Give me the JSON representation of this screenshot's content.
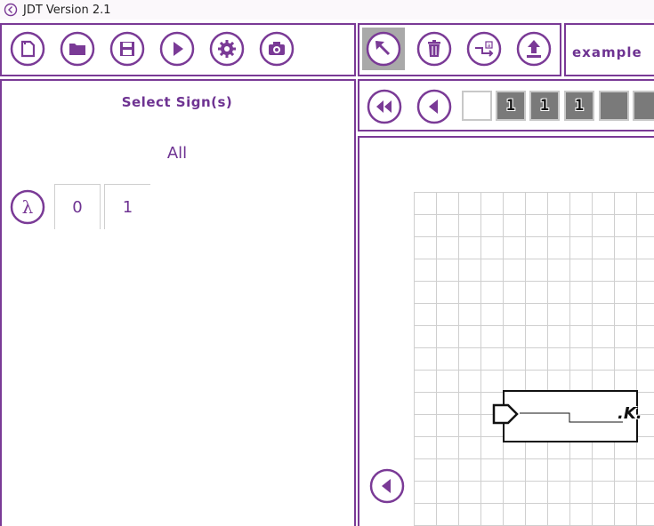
{
  "window": {
    "title": "JDT Version 2.1"
  },
  "toolbar_left": {
    "buttons": [
      {
        "name": "new-file",
        "icon": "new-file-icon"
      },
      {
        "name": "open-folder",
        "icon": "folder-icon"
      },
      {
        "name": "save",
        "icon": "save-icon"
      },
      {
        "name": "run",
        "icon": "play-icon"
      },
      {
        "name": "settings",
        "icon": "gear-icon"
      },
      {
        "name": "screenshot",
        "icon": "camera-icon"
      }
    ]
  },
  "toolbar_right": {
    "buttons": [
      {
        "name": "select-tool",
        "icon": "pointer-arrow-icon",
        "selected": true
      },
      {
        "name": "delete",
        "icon": "trash-icon"
      },
      {
        "name": "transition-tool",
        "icon": "transition-icon"
      },
      {
        "name": "upload",
        "icon": "upload-icon"
      }
    ],
    "machine_name": "example"
  },
  "sign_panel": {
    "heading": "Select Sign(s)",
    "all_label": "All",
    "signs": [
      "λ",
      "0",
      "1"
    ]
  },
  "tape": {
    "cells": [
      "",
      "1",
      "1",
      "1",
      "",
      ""
    ]
  },
  "canvas": {
    "transition_label": ".K."
  },
  "colors": {
    "accent": "#7a3a96",
    "text_accent": "#6e3392",
    "selected": "#a9a9a9",
    "tape_filled": "#7a7a7a",
    "grid": "#cfcfcf"
  }
}
